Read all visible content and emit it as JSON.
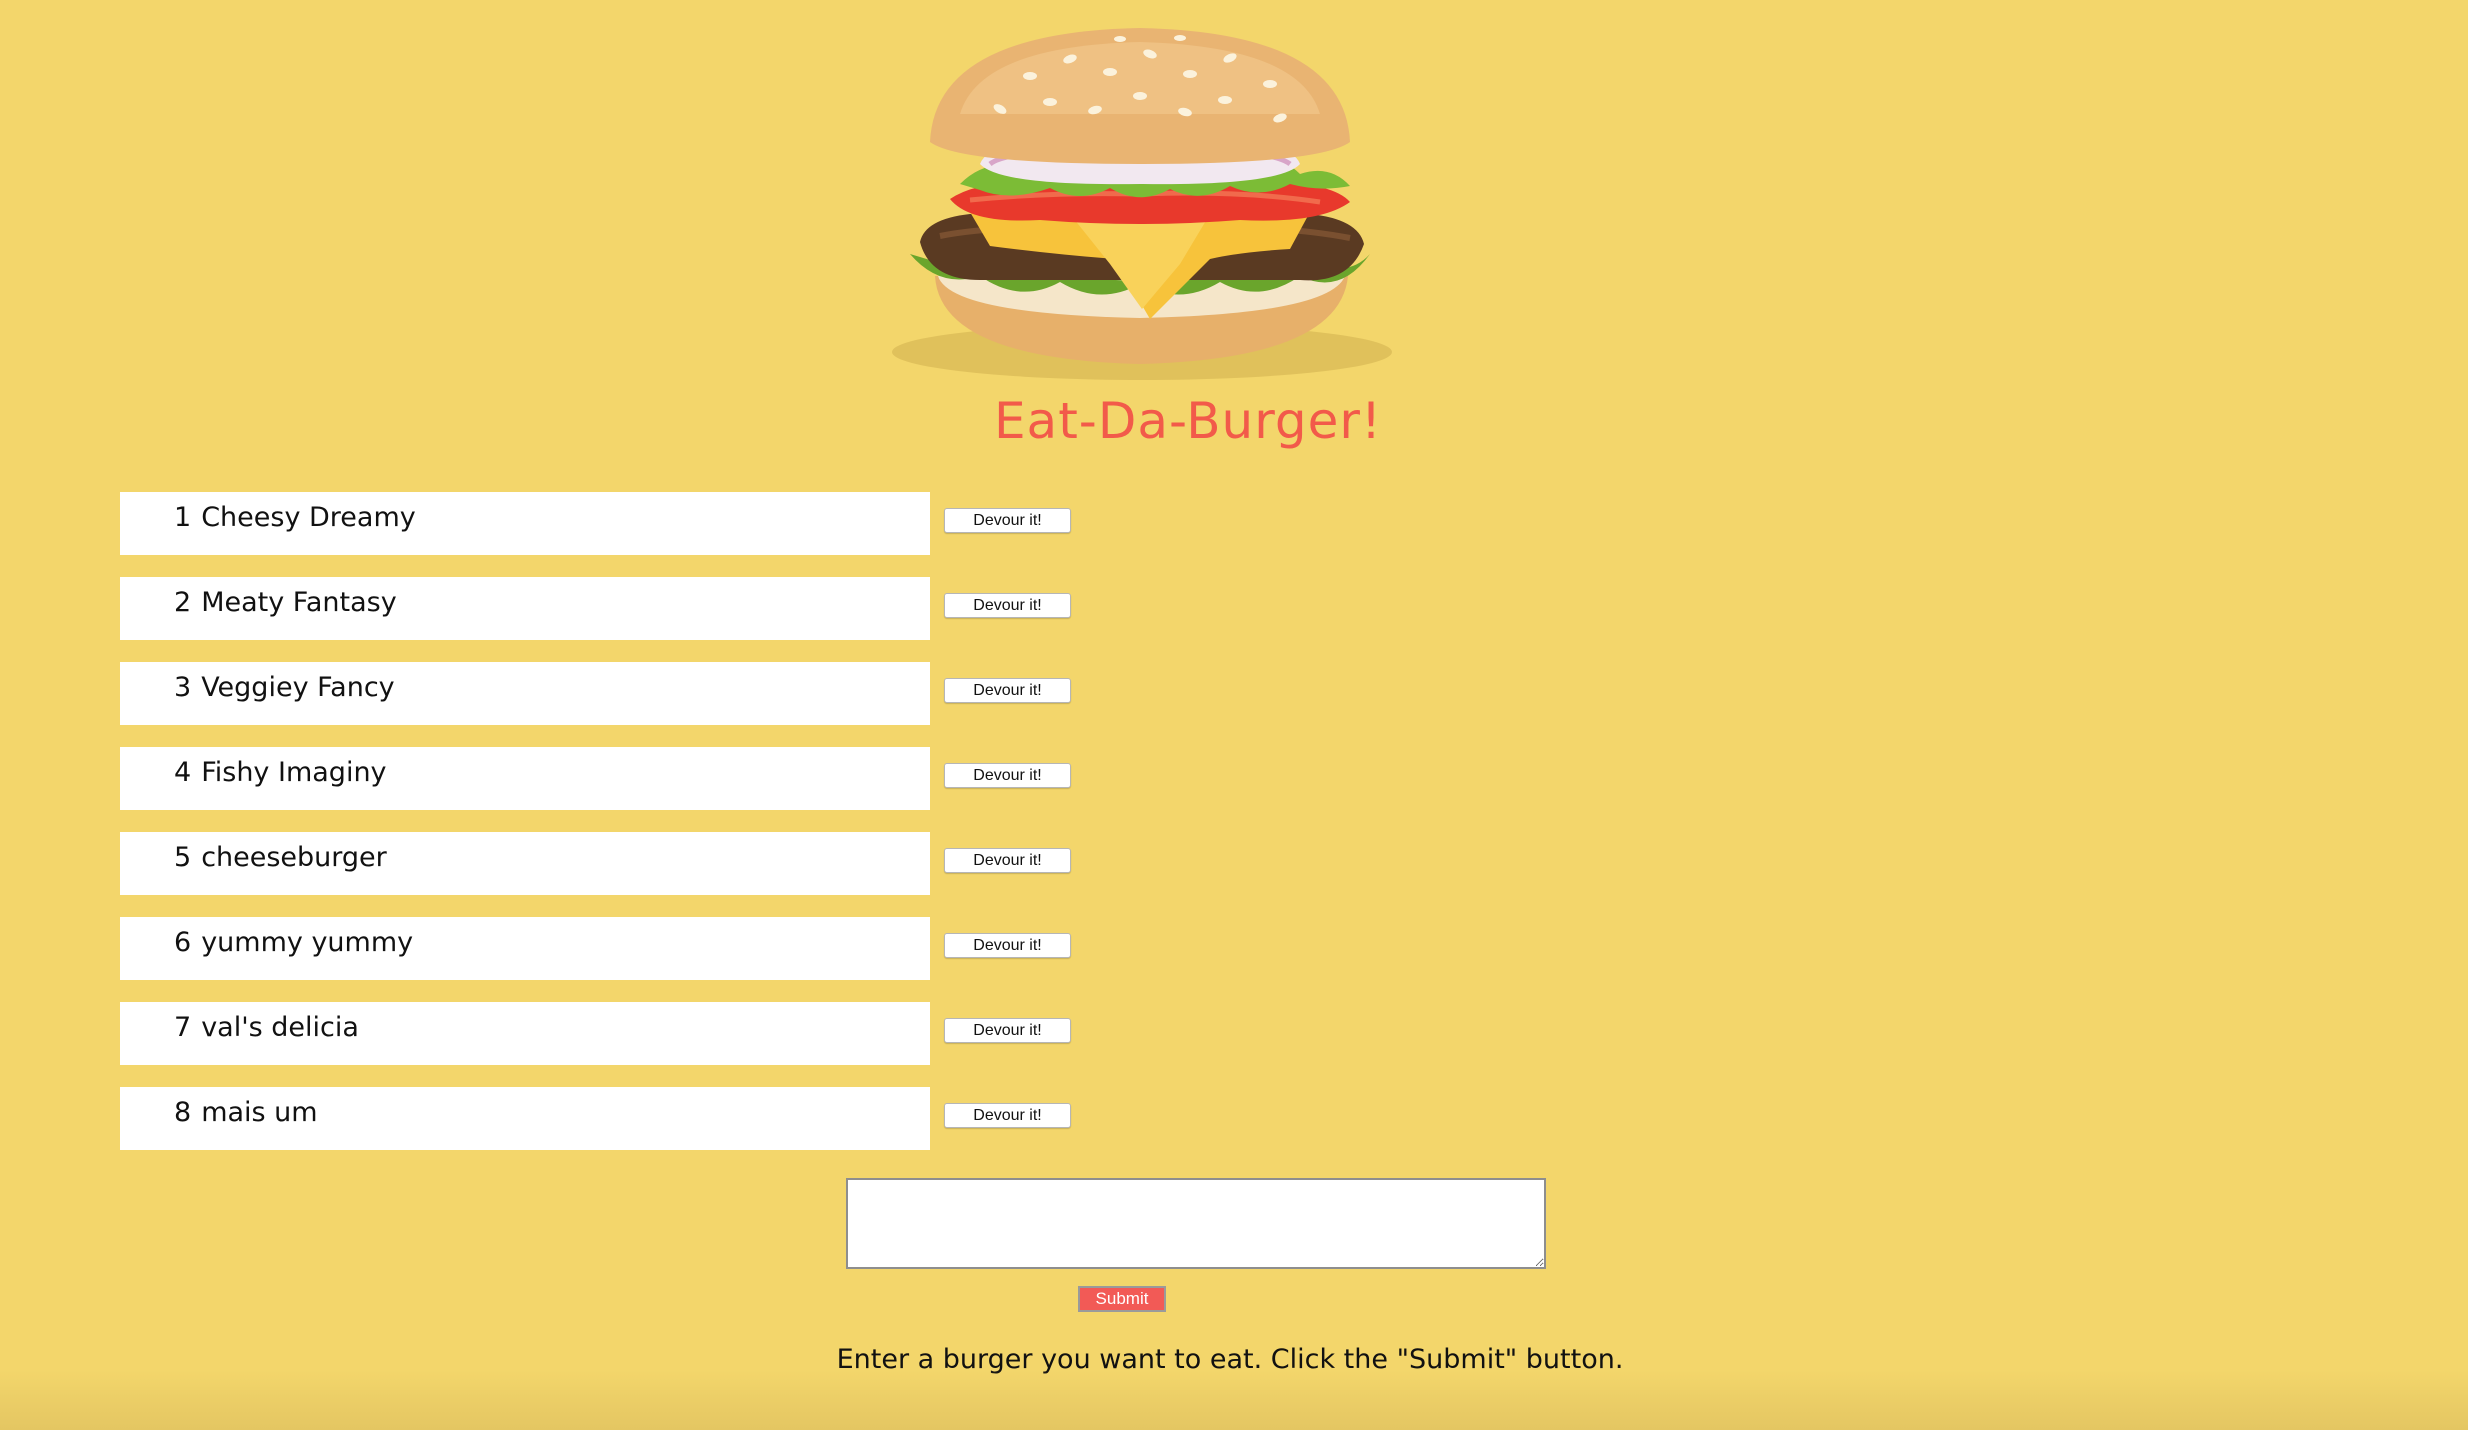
{
  "header": {
    "title": "Eat-Da-Burger!",
    "logo_icon": "burger-icon"
  },
  "burgers": [
    {
      "num": "1",
      "name": "Cheesy Dreamy",
      "button_label": "Devour it!"
    },
    {
      "num": "2",
      "name": "Meaty Fantasy",
      "button_label": "Devour it!"
    },
    {
      "num": "3",
      "name": "Veggiey Fancy",
      "button_label": "Devour it!"
    },
    {
      "num": "4",
      "name": "Fishy Imaginy",
      "button_label": "Devour it!"
    },
    {
      "num": "5",
      "name": "cheeseburger",
      "button_label": "Devour it!"
    },
    {
      "num": "6",
      "name": "yummy yummy",
      "button_label": "Devour it!"
    },
    {
      "num": "7",
      "name": "val's delicia",
      "button_label": "Devour it!"
    },
    {
      "num": "8",
      "name": "mais um",
      "button_label": "Devour it!"
    }
  ],
  "form": {
    "textarea_value": "",
    "submit_label": "Submit",
    "instructions": "Enter a burger you want to eat. Click the \"Submit\" button."
  },
  "colors": {
    "background": "#f3d66b",
    "title": "#f25a4a",
    "submit": "#f25a56"
  }
}
